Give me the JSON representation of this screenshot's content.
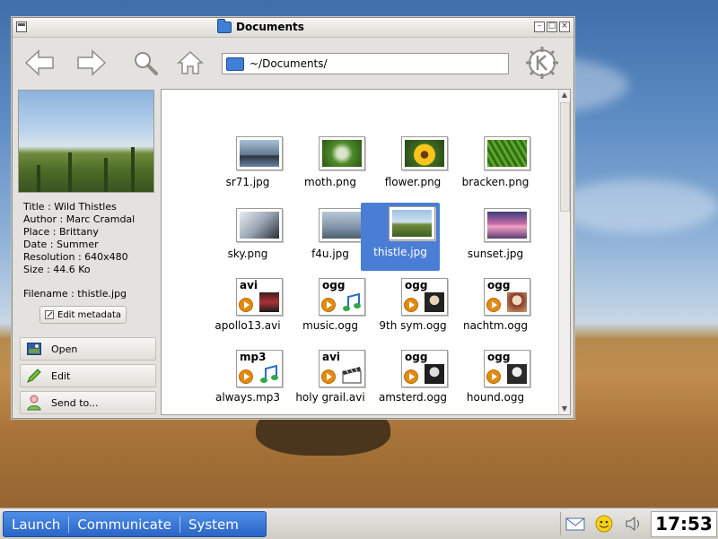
{
  "window": {
    "title": "Documents",
    "address": "~/Documents/",
    "controls": {
      "minimize": "–",
      "maximize": "□",
      "close": "×"
    }
  },
  "toolbar": {
    "icons": [
      "back-arrow-icon",
      "forward-arrow-icon",
      "search-icon",
      "home-icon",
      "kde-logo-icon"
    ]
  },
  "preview": {
    "title": "Title : Wild Thistles",
    "author": "Author : Marc Cramdal",
    "place": "Place : Brittany",
    "date": "Date : Summer",
    "resolution": "Resolution : 640x480",
    "size": "Size : 44.6 Ko",
    "filename": "Filename : thistle.jpg",
    "edit_metadata": "Edit metadata"
  },
  "actions": [
    {
      "label": "Open",
      "icon": "image-icon"
    },
    {
      "label": "Edit",
      "icon": "pencil-icon"
    },
    {
      "label": "Send to...",
      "icon": "user-send-icon"
    }
  ],
  "files": [
    {
      "name": "sr71.jpg",
      "kind": "image",
      "selected": false
    },
    {
      "name": "moth.png",
      "kind": "image",
      "selected": false
    },
    {
      "name": "flower.png",
      "kind": "image",
      "selected": false
    },
    {
      "name": "bracken.png",
      "kind": "image",
      "selected": false
    },
    {
      "name": "sky.png",
      "kind": "image",
      "selected": false
    },
    {
      "name": "f4u.jpg",
      "kind": "image",
      "selected": false
    },
    {
      "name": "thistle.jpg",
      "kind": "image",
      "selected": true
    },
    {
      "name": "sunset.jpg",
      "kind": "image",
      "selected": false
    },
    {
      "name": "apollo13.avi",
      "kind": "media",
      "tag": "avi",
      "selected": false
    },
    {
      "name": "music.ogg",
      "kind": "media",
      "tag": "ogg",
      "selected": false
    },
    {
      "name": "9th sym.ogg",
      "kind": "media",
      "tag": "ogg",
      "selected": false
    },
    {
      "name": "nachtm.ogg",
      "kind": "media",
      "tag": "ogg",
      "selected": false
    },
    {
      "name": "always.mp3",
      "kind": "media",
      "tag": "mp3",
      "selected": false
    },
    {
      "name": "holy grail.avi",
      "kind": "media",
      "tag": "avi",
      "selected": false
    },
    {
      "name": "amsterd.ogg",
      "kind": "media",
      "tag": "ogg",
      "selected": false
    },
    {
      "name": "hound.ogg",
      "kind": "media",
      "tag": "ogg",
      "selected": false
    }
  ],
  "taskbar": {
    "launch": "Launch",
    "communicate": "Communicate",
    "system": "System",
    "clock": "17:53",
    "tray_icons": [
      "mail-icon",
      "smiley-icon",
      "speaker-icon"
    ]
  },
  "colors": {
    "selection": "#4a7ed6",
    "launcher": "#2a64c6",
    "window_bg": "#e4e2de"
  }
}
